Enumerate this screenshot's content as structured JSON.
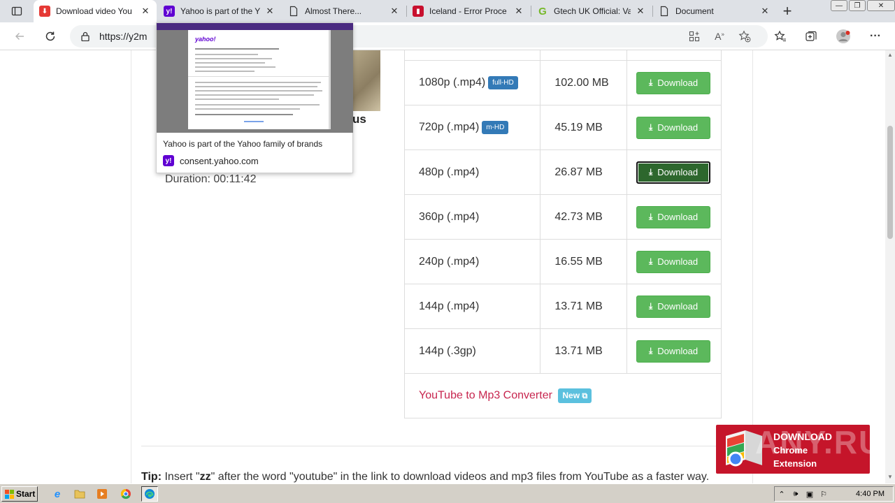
{
  "tabs": [
    {
      "title": "Download video You",
      "favicon": "y2mate-download-icon",
      "color": "#e53935",
      "active": true
    },
    {
      "title": "Yahoo is part of the Y",
      "favicon": "yahoo-icon",
      "color": "#6001d2",
      "active": false
    },
    {
      "title": "Almost There...",
      "favicon": "document-icon",
      "color": "",
      "active": false
    },
    {
      "title": "Iceland - Error Proce",
      "favicon": "iceland-icon",
      "color": "#c8102e",
      "active": false
    },
    {
      "title": "Gtech UK Official: Va",
      "favicon": "gtech-icon",
      "color": "#76b82a",
      "active": false
    },
    {
      "title": "Document",
      "favicon": "document-icon",
      "color": "",
      "active": false
    }
  ],
  "address": {
    "url": "https://y2m"
  },
  "hovercard": {
    "title": "Yahoo is part of the Yahoo family of brands",
    "domain": "consent.yahoo.com",
    "preview_logo": "yahoo!"
  },
  "video": {
    "title_fragment": "us",
    "duration": "Duration: 00:11:42"
  },
  "downloads": {
    "rows": [
      {
        "quality": "1080p (.mp4)",
        "badge": "full-HD",
        "size": "102.00 MB",
        "button": "Download",
        "focused": false
      },
      {
        "quality": "720p (.mp4)",
        "badge": "m-HD",
        "size": "45.19 MB",
        "button": "Download",
        "focused": false
      },
      {
        "quality": "480p (.mp4)",
        "badge": "",
        "size": "26.87 MB",
        "button": "Download",
        "focused": true
      },
      {
        "quality": "360p (.mp4)",
        "badge": "",
        "size": "42.73 MB",
        "button": "Download",
        "focused": false
      },
      {
        "quality": "240p (.mp4)",
        "badge": "",
        "size": "16.55 MB",
        "button": "Download",
        "focused": false
      },
      {
        "quality": "144p (.mp4)",
        "badge": "",
        "size": "13.71 MB",
        "button": "Download",
        "focused": false
      },
      {
        "quality": "144p (.3gp)",
        "badge": "",
        "size": "13.71 MB",
        "button": "Download",
        "focused": false
      }
    ],
    "converter_link": "YouTube to Mp3 Converter",
    "converter_badge": "New"
  },
  "tip": {
    "label": "Tip:",
    "text_before": "Insert \"",
    "keyword": "zz",
    "text_after": "\" after the word \"youtube\" in the link to download videos and mp3 files from YouTube as a faster way."
  },
  "chrome_extension": {
    "line1": "DOWNLOAD",
    "line2": "Chrome",
    "line3": "Extension"
  },
  "watermark": "ANY.RUN",
  "taskbar": {
    "start_label": "Start",
    "clock": "4:40 PM"
  },
  "colors": {
    "download_button": "#5cb85c",
    "download_button_focused": "#2d672d",
    "badge_blue": "#337ab7",
    "badge_new": "#5bc0de",
    "converter_link": "#c7254e",
    "extension_banner": "#c5152a"
  }
}
